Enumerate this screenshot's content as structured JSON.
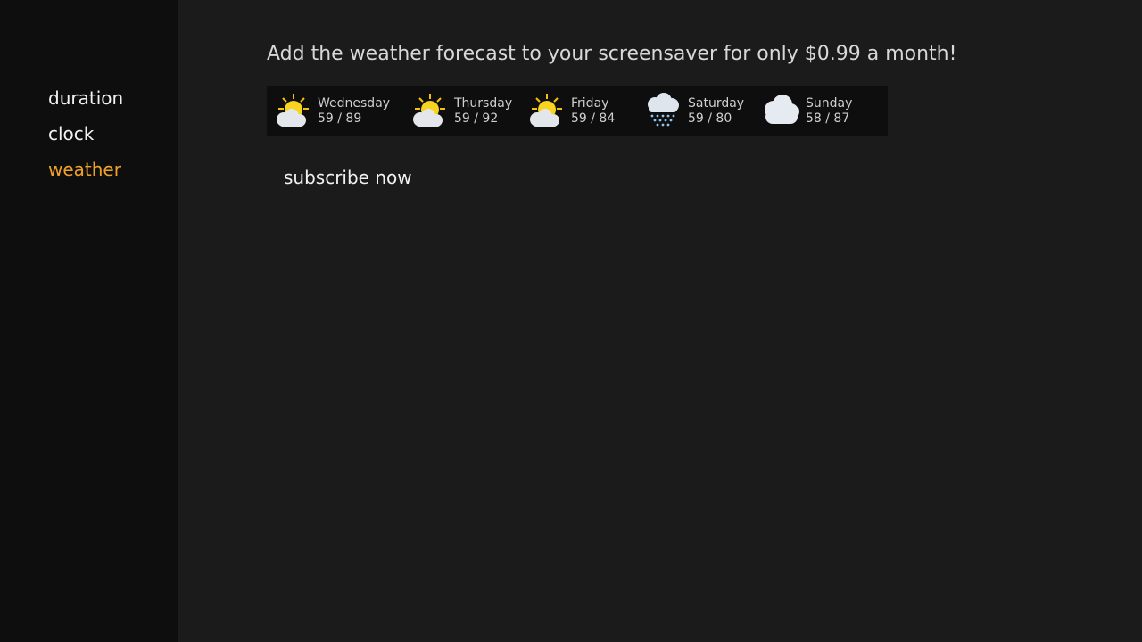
{
  "menu": {
    "items": [
      {
        "label": "duration",
        "active": false
      },
      {
        "label": "clock",
        "active": false
      },
      {
        "label": "weather",
        "active": true
      }
    ]
  },
  "promo": {
    "text": "Add the weather forecast to your screensaver for only $0.99 a month!"
  },
  "forecast": {
    "days": [
      {
        "name": "Wednesday",
        "temps": "59 / 89",
        "icon": "partly-sunny-icon"
      },
      {
        "name": "Thursday",
        "temps": "59 / 92",
        "icon": "partly-sunny-icon"
      },
      {
        "name": "Friday",
        "temps": "59 / 84",
        "icon": "partly-sunny-icon"
      },
      {
        "name": "Saturday",
        "temps": "59 / 80",
        "icon": "rain-icon"
      },
      {
        "name": "Sunday",
        "temps": "58 / 87",
        "icon": "cloudy-icon"
      }
    ]
  },
  "subscribe": {
    "label": "subscribe now"
  },
  "colors": {
    "active_accent": "#f0a12b",
    "sidebar_bg": "#0e0e0e",
    "page_bg": "#1b1b1b"
  }
}
